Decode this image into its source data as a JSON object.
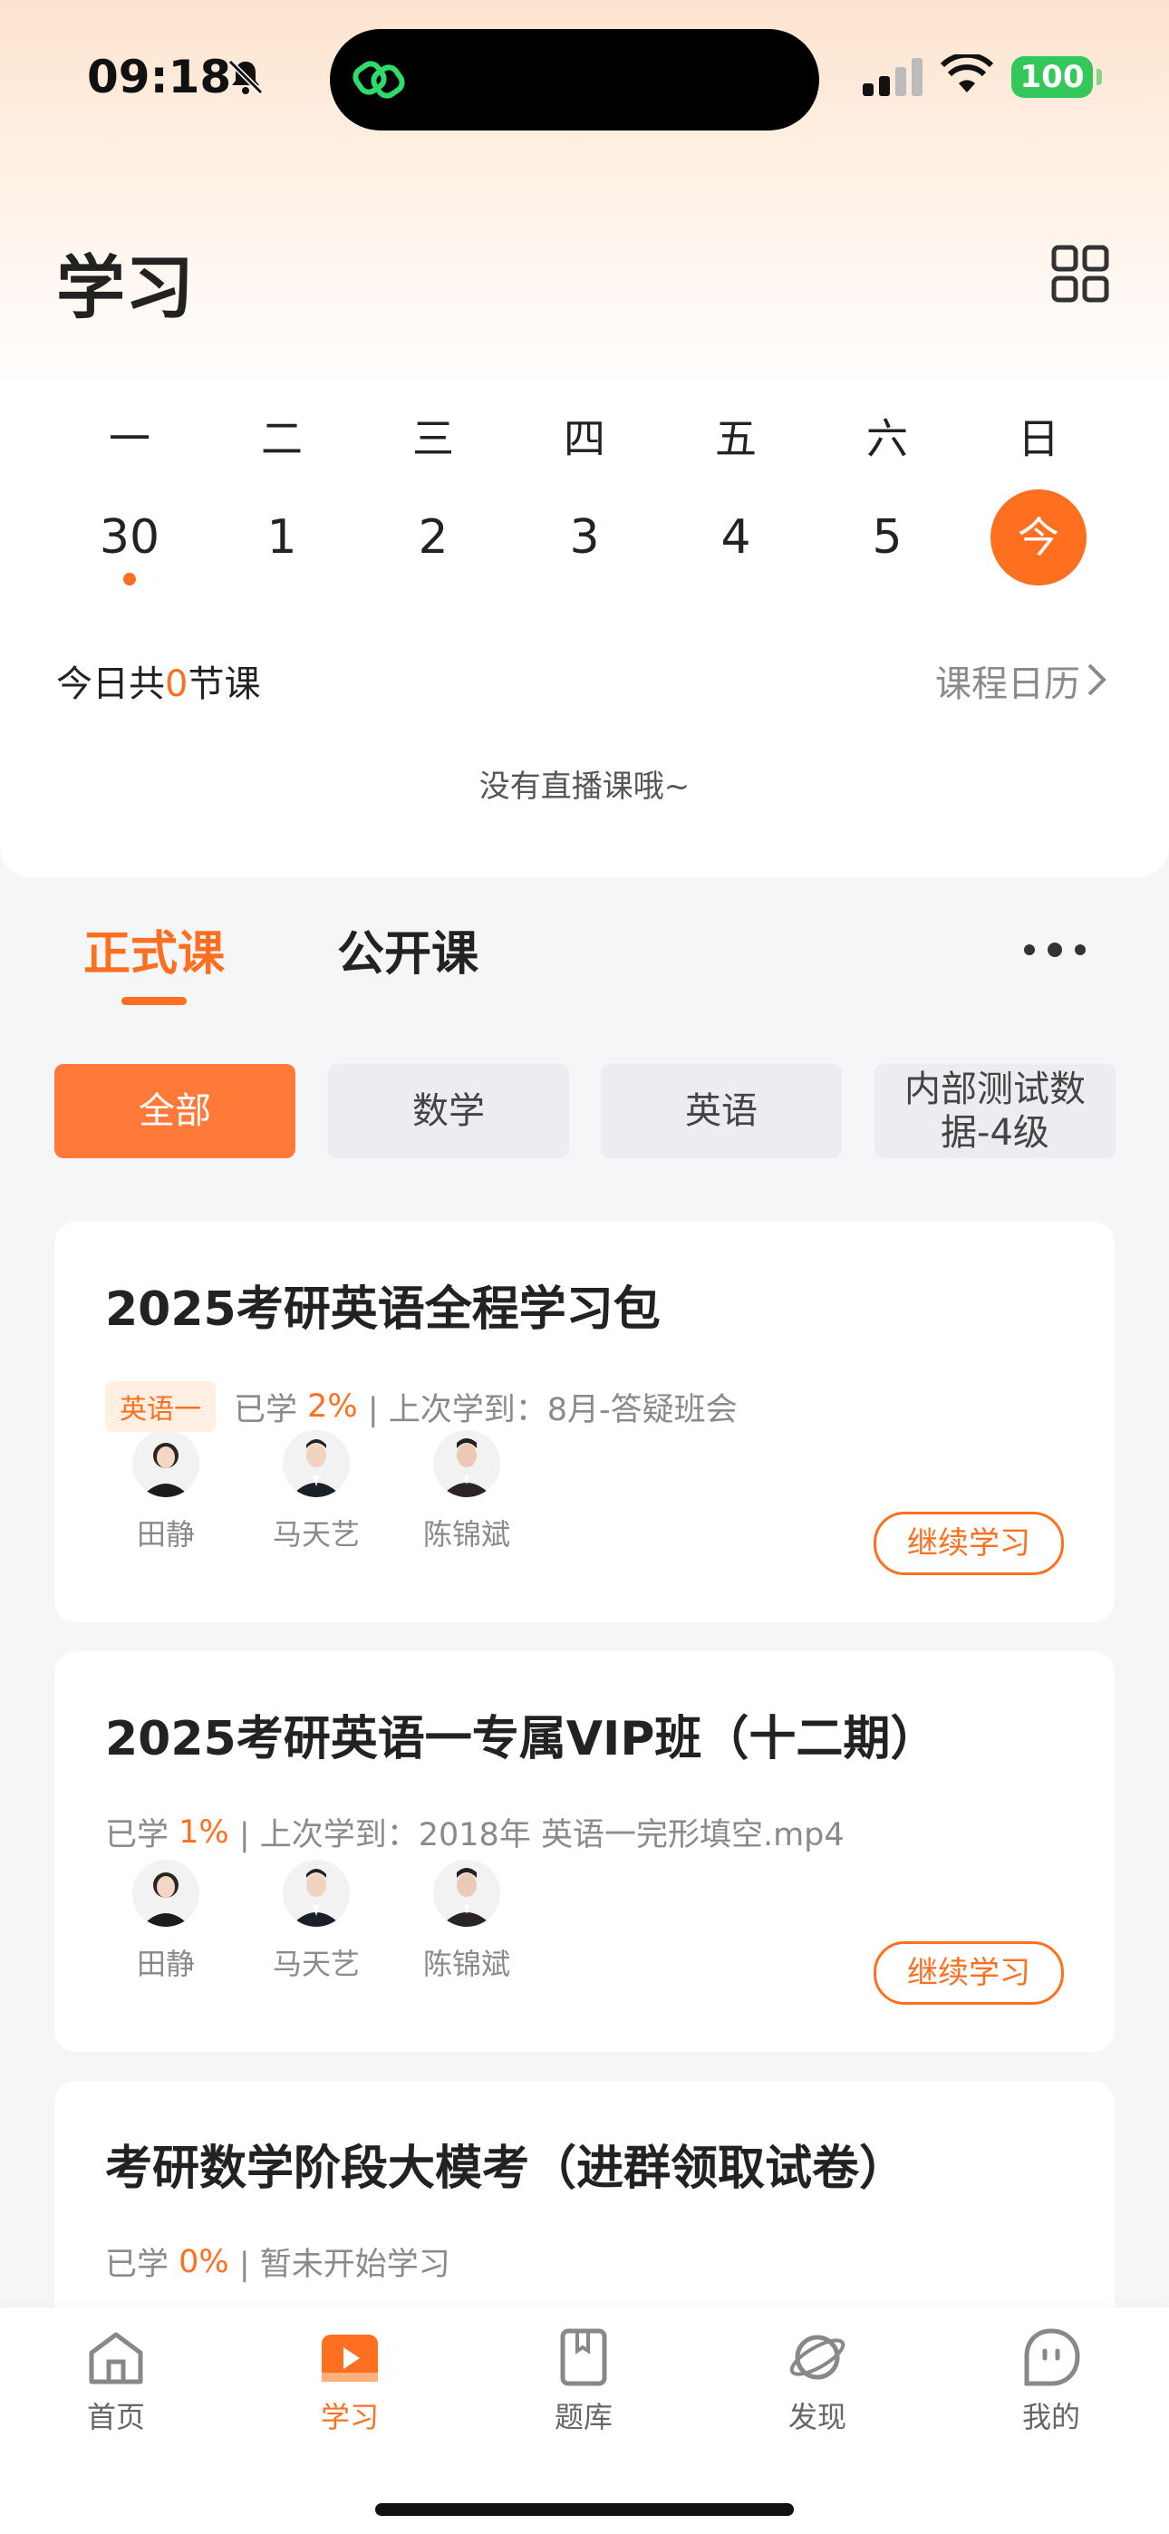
{
  "status_bar": {
    "time": "09:18",
    "battery": "100"
  },
  "header": {
    "title": "学习"
  },
  "calendar": {
    "weekdays": [
      "一",
      "二",
      "三",
      "四",
      "五",
      "六",
      "日"
    ],
    "days": [
      "30",
      "1",
      "2",
      "3",
      "4",
      "5",
      "今"
    ],
    "summary_prefix": "今日共",
    "summary_count": "0",
    "summary_suffix": "节课",
    "calendar_link": "课程日历",
    "no_live": "没有直播课哦~"
  },
  "tabs": {
    "formal": "正式课",
    "public": "公开课"
  },
  "filters": [
    "全部",
    "数学",
    "英语",
    "内部测试数据-4级"
  ],
  "courses": [
    {
      "title": "2025考研英语全程学习包",
      "tag": "英语一",
      "studied_label": "已学",
      "progress": "2%",
      "last_label": "| 上次学到：8月-答疑班会",
      "teachers": [
        "田静",
        "马天艺",
        "陈锦斌"
      ],
      "button": "继续学习"
    },
    {
      "title": "2025考研英语一专属VIP班（十二期）",
      "studied_label": "已学",
      "progress": "1%",
      "last_label": "| 上次学到：2018年 英语一完形填空.mp4",
      "teachers": [
        "田静",
        "马天艺",
        "陈锦斌"
      ],
      "button": "继续学习"
    },
    {
      "title": "考研数学阶段大模考（进群领取试卷）",
      "studied_label": "已学",
      "progress": "0%",
      "last_label": "| 暂未开始学习"
    }
  ],
  "bottom_nav": [
    {
      "label": "首页",
      "icon": "home-icon"
    },
    {
      "label": "学习",
      "icon": "play-icon"
    },
    {
      "label": "题库",
      "icon": "book-icon"
    },
    {
      "label": "发现",
      "icon": "planet-icon"
    },
    {
      "label": "我的",
      "icon": "profile-icon"
    }
  ],
  "colors": {
    "accent": "#ff6f20",
    "battery": "#34c759"
  }
}
